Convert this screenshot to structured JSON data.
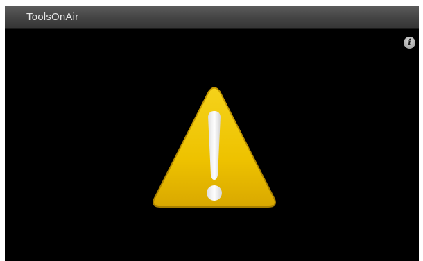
{
  "window": {
    "title": "ToolsOnAir"
  },
  "info": {
    "icon": "info-icon",
    "glyph": "i"
  },
  "alert": {
    "icon": "warning-icon",
    "accent_color": "#f0c400",
    "symbol_color": "#f2f2f2"
  }
}
